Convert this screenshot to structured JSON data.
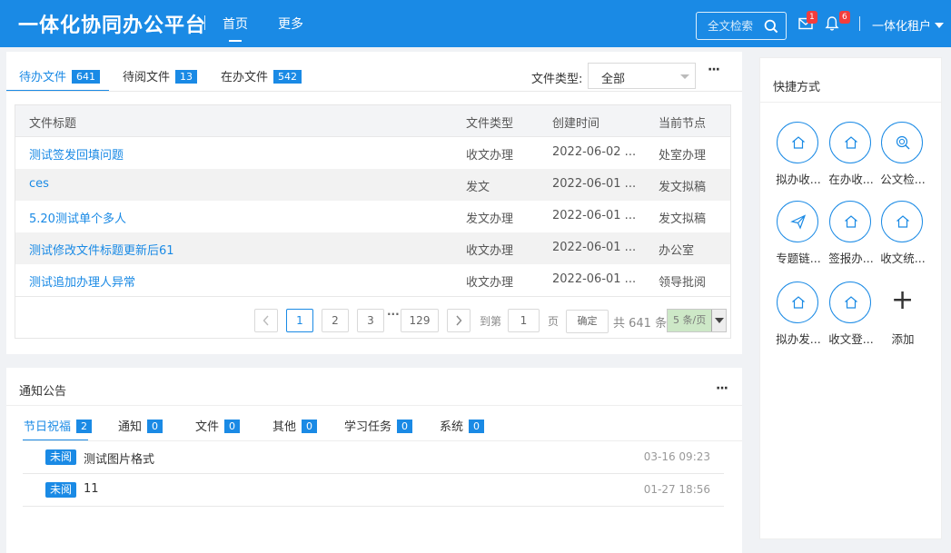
{
  "header": {
    "logo": "一体化协同办公平台",
    "nav": [
      {
        "label": "首页"
      },
      {
        "label": "更多"
      }
    ],
    "search_placeholder": "全文检索",
    "mail_badge": "1",
    "bell_badge": "6",
    "tenant": "一体化租户",
    "accent_color": "#1a8ae5"
  },
  "docs": {
    "tabs": [
      {
        "label": "待办文件",
        "count": "641"
      },
      {
        "label": "待阅文件",
        "count": "13"
      },
      {
        "label": "在办文件",
        "count": "542"
      }
    ],
    "filter_label": "文件类型:",
    "filter_value": "全部",
    "more": "···",
    "columns": [
      "文件标题",
      "文件类型",
      "创建时间",
      "当前节点"
    ],
    "rows": [
      {
        "title": "测试签发回填问题",
        "type": "收文办理",
        "time": "2022-06-02 ...",
        "node": "处室办理"
      },
      {
        "title": "ces",
        "type": "发文",
        "time": "2022-06-01 ...",
        "node": "发文拟稿"
      },
      {
        "title": "5.20测试单个多人",
        "type": "发文办理",
        "time": "2022-06-01 ...",
        "node": "发文拟稿"
      },
      {
        "title": "测试修改文件标题更新后61",
        "type": "收文办理",
        "time": "2022-06-01 ...",
        "node": "办公室"
      },
      {
        "title": "测试追加办理人异常",
        "type": "收文办理",
        "time": "2022-06-01 ...",
        "node": "领导批阅"
      }
    ],
    "pagination": {
      "pages": [
        "1",
        "2",
        "3",
        "129"
      ],
      "ellipsis": "···",
      "goto_prefix": "到第",
      "goto_value": "1",
      "goto_suffix": "页",
      "confirm": "确定",
      "total": "共 641 条",
      "page_size": "5 条/页"
    }
  },
  "notice": {
    "title": "通知公告",
    "more": "···",
    "tabs": [
      {
        "label": "节日祝福",
        "count": "2"
      },
      {
        "label": "通知",
        "count": "0"
      },
      {
        "label": "文件",
        "count": "0"
      },
      {
        "label": "其他",
        "count": "0"
      },
      {
        "label": "学习任务",
        "count": "0"
      },
      {
        "label": "系统",
        "count": "0"
      }
    ],
    "items": [
      {
        "tag": "未阅",
        "text": "测试图片格式",
        "time": "03-16 09:23"
      },
      {
        "tag": "未阅",
        "text": "11",
        "time": "01-27 18:56"
      }
    ]
  },
  "quick": {
    "title": "快捷方式",
    "items": [
      {
        "label": "拟办收...",
        "icon": "home-icon"
      },
      {
        "label": "在办收...",
        "icon": "home-icon"
      },
      {
        "label": "公文检...",
        "icon": "search-icon"
      },
      {
        "label": "专题链...",
        "icon": "paper-plane-icon"
      },
      {
        "label": "签报办...",
        "icon": "home-icon"
      },
      {
        "label": "收文统...",
        "icon": "home-icon"
      },
      {
        "label": "拟办发...",
        "icon": "home-icon"
      },
      {
        "label": "收文登...",
        "icon": "home-icon"
      }
    ],
    "add_label": "添加",
    "add_icon": "+"
  }
}
